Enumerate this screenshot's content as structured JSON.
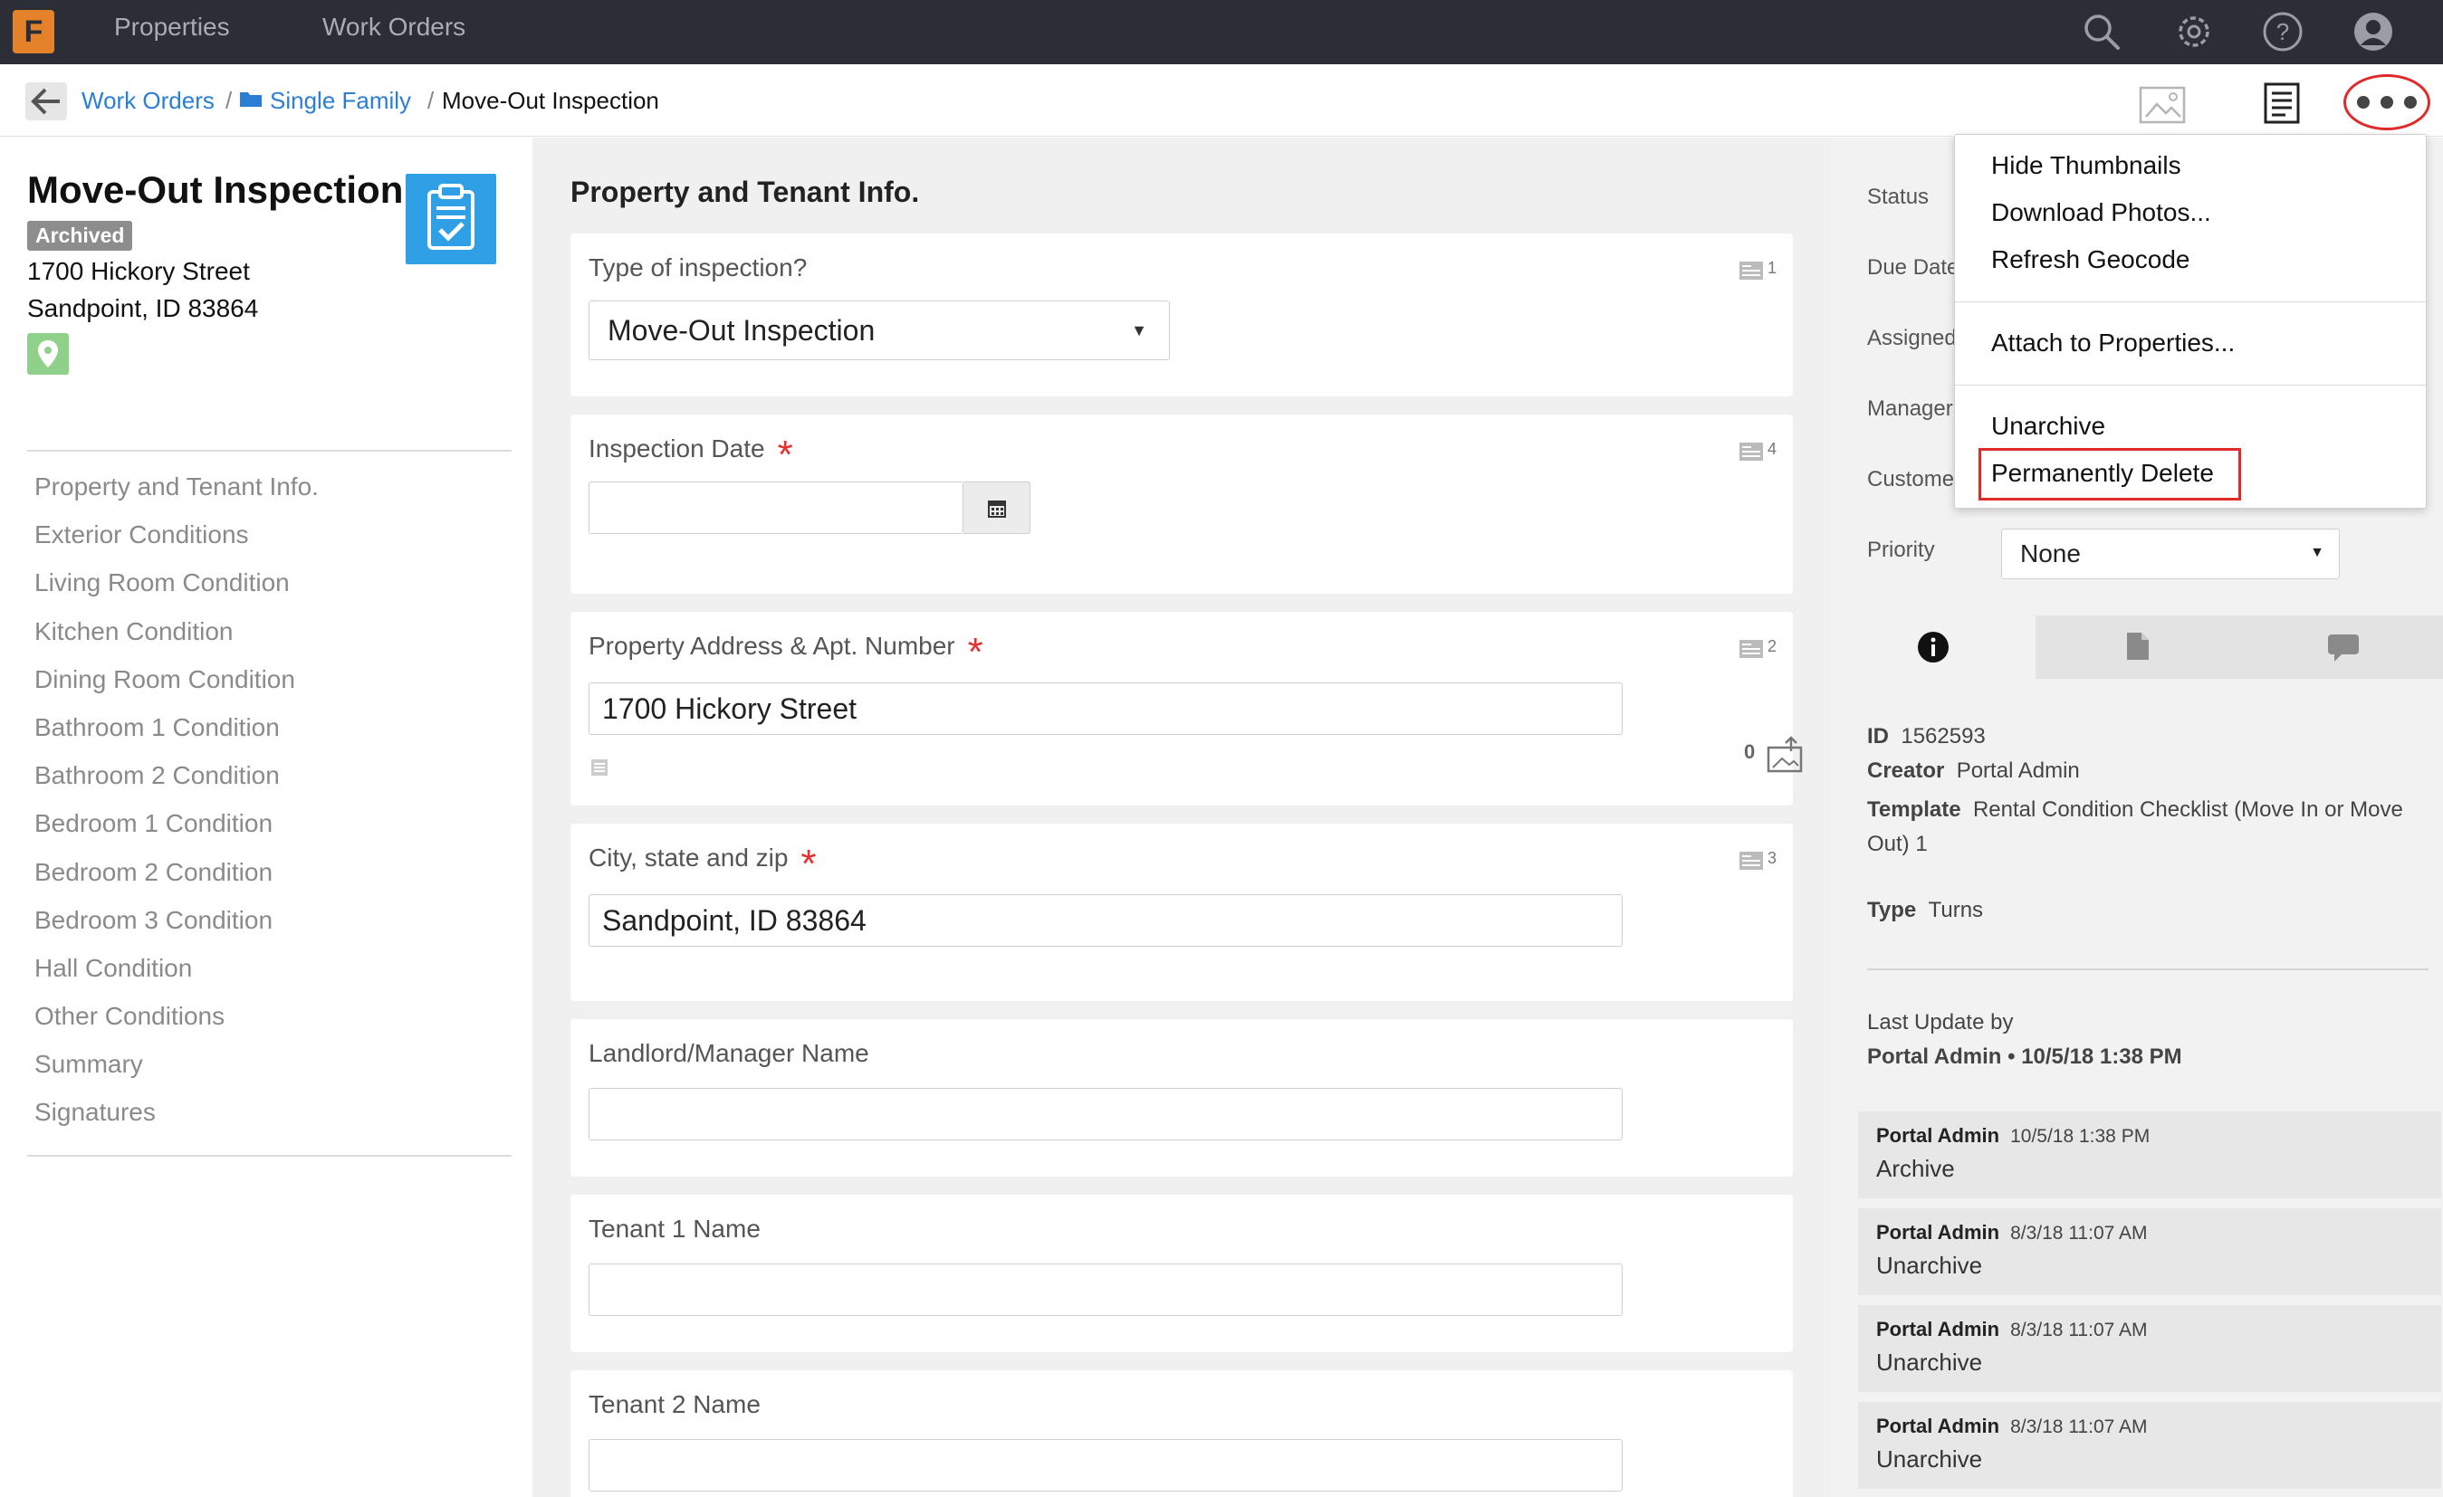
{
  "nav": {
    "logo_text": "F",
    "properties": "Properties",
    "work_orders": "Work Orders",
    "icons": [
      "search-icon",
      "gear-icon",
      "help-icon",
      "user-icon"
    ]
  },
  "breadcrumb": {
    "work_orders": "Work Orders",
    "sep1": "/",
    "single_family": "Single Family",
    "sep2": "/",
    "current": "Move-Out Inspection"
  },
  "work_order": {
    "title": "Move-Out Inspection",
    "status_badge": "Archived",
    "address_line1": "1700 Hickory Street",
    "address_line2": "Sandpoint, ID 83864"
  },
  "left_nav": {
    "items": [
      "Property and Tenant Info.",
      "Exterior Conditions",
      "Living Room Condition",
      "Kitchen Condition",
      "Dining Room Condition",
      "Bathroom 1 Condition",
      "Bathroom 2 Condition",
      "Bedroom 1 Condition",
      "Bedroom 2 Condition",
      "Bedroom 3 Condition",
      "Hall Condition",
      "Other Conditions",
      "Summary",
      "Signatures"
    ]
  },
  "form": {
    "section_title": "Property and Tenant Info.",
    "type_label": "Type of inspection?",
    "type_count": "1",
    "type_value": "Move-Out Inspection",
    "date_label": "Inspection Date",
    "date_count": "4",
    "date_value": "",
    "address_label": "Property Address & Apt. Number",
    "address_count": "2",
    "address_value": "1700 Hickory Street",
    "address_photo_count": "0",
    "city_label": "City, state and zip",
    "city_count": "3",
    "city_value": "Sandpoint, ID 83864",
    "landlord_label": "Landlord/Manager Name",
    "landlord_value": "",
    "tenant1_label": "Tenant 1 Name",
    "tenant1_value": "",
    "tenant2_label": "Tenant 2 Name",
    "tenant2_value": "",
    "required_mark": "*"
  },
  "right_panel": {
    "status_label": "Status",
    "due_date_label": "Due Date",
    "assigned_label": "Assigned",
    "manager_label": "Manager",
    "customer_label": "Custome",
    "priority_label": "Priority",
    "priority_value": "None",
    "tabs": [
      "info-icon",
      "document-icon",
      "comment-icon"
    ],
    "id_label": "ID",
    "id_value": "1562593",
    "creator_label": "Creator",
    "creator_value": "Portal Admin",
    "template_label": "Template",
    "template_value": "Rental Condition Checklist (Move In or Move Out) 1",
    "type_label": "Type",
    "type_value": "Turns",
    "last_update_label": "Last Update by",
    "last_update_value": "Portal Admin • 10/5/18 1:38 PM",
    "activity": [
      {
        "user": "Portal Admin",
        "time": "10/5/18 1:38 PM",
        "action": "Archive"
      },
      {
        "user": "Portal Admin",
        "time": "8/3/18 11:07 AM",
        "action": "Unarchive"
      },
      {
        "user": "Portal Admin",
        "time": "8/3/18 11:07 AM",
        "action": "Unarchive"
      },
      {
        "user": "Portal Admin",
        "time": "8/3/18 11:07 AM",
        "action": "Unarchive"
      }
    ]
  },
  "menu": {
    "hide_thumbnails": "Hide Thumbnails",
    "download_photos": "Download Photos...",
    "refresh_geocode": "Refresh Geocode",
    "attach_properties": "Attach to Properties...",
    "unarchive": "Unarchive",
    "permanently_delete": "Permanently Delete"
  },
  "colors": {
    "topnav": "#2b2e36",
    "logo": "#e4822b",
    "link": "#2a7fd4",
    "clipboard_tile": "#2fa0e6",
    "map_pin": "#8fd18a",
    "required": "#e53030",
    "highlight": "#e02a2a"
  }
}
